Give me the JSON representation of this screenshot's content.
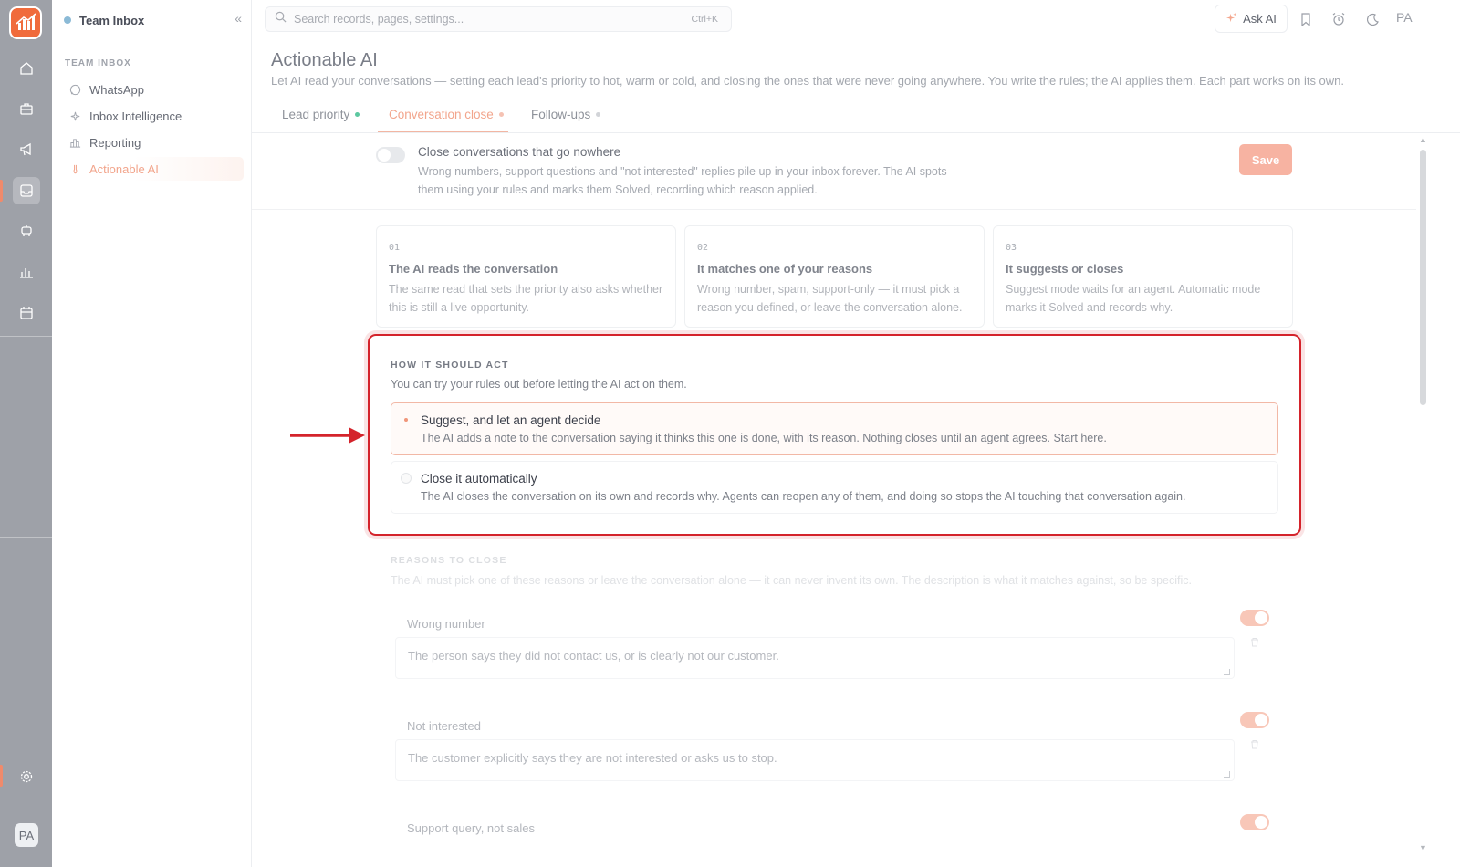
{
  "sidebar": {
    "title": "Team Inbox",
    "collapse_glyph": "«",
    "section_label": "TEAM INBOX",
    "items": [
      {
        "label": "WhatsApp",
        "icon": "whatsapp-icon"
      },
      {
        "label": "Inbox Intelligence",
        "icon": "sparkle-icon"
      },
      {
        "label": "Reporting",
        "icon": "bar-chart-icon"
      },
      {
        "label": "Actionable AI",
        "icon": "flask-icon",
        "active": true
      }
    ]
  },
  "rail": {
    "avatar": "PA",
    "icons": [
      "home-icon",
      "briefcase-icon",
      "megaphone-icon",
      "inbox-icon",
      "robot-icon",
      "chart-icon",
      "calendar-icon",
      "settings-icon"
    ]
  },
  "topbar": {
    "search_placeholder": "Search records, pages, settings...",
    "shortcut": "Ctrl+K",
    "ask_ai": "Ask AI",
    "avatar": "PA"
  },
  "page": {
    "title": "Actionable AI",
    "subtitle": "Let AI read your conversations — setting each lead's priority to hot, warm or cold, and closing the ones that were never going anywhere. You write the rules; the AI applies them. Each part works on its own."
  },
  "tabs": [
    {
      "label": "Lead priority",
      "dot_color": "#5cc8a0"
    },
    {
      "label": "Conversation close",
      "dot_color": "#f5c2b3",
      "active": true
    },
    {
      "label": "Follow-ups",
      "dot_color": "#d2d4d8"
    }
  ],
  "close_setting": {
    "title": "Close conversations that go nowhere",
    "description": "Wrong numbers, support questions and \"not interested\" replies pile up in your inbox forever. The AI spots them using your rules and marks them Solved, recording which reason applied.",
    "enabled": false,
    "save_label": "Save"
  },
  "steps": [
    {
      "num": "01",
      "title": "The AI reads the conversation",
      "desc": "The same read that sets the priority also asks whether this is still a live opportunity."
    },
    {
      "num": "02",
      "title": "It matches one of your reasons",
      "desc": "Wrong number, spam, support-only — it must pick a reason you defined, or leave the conversation alone."
    },
    {
      "num": "03",
      "title": "It suggests or closes",
      "desc": "Suggest mode waits for an agent. Automatic mode marks it Solved and records why."
    }
  ],
  "act": {
    "label": "HOW IT SHOULD ACT",
    "hint": "You can try your rules out before letting the AI act on them.",
    "options": [
      {
        "title": "Suggest, and let an agent decide",
        "desc": "The AI adds a note to the conversation saying it thinks this one is done, with its reason. Nothing closes until an agent agrees. Start here.",
        "selected": true
      },
      {
        "title": "Close it automatically",
        "desc": "The AI closes the conversation on its own and records why. Agents can reopen any of them, and doing so stops the AI touching that conversation again.",
        "selected": false
      }
    ]
  },
  "reasons": {
    "label": "REASONS TO CLOSE",
    "hint": "The AI must pick one of these reasons or leave the conversation alone — it can never invent its own. The description is what it matches against, so be specific.",
    "items": [
      {
        "name": "Wrong number",
        "desc": "The person says they did not contact us, or is clearly not our customer.",
        "enabled": true
      },
      {
        "name": "Not interested",
        "desc": "The customer explicitly says they are not interested or asks us to stop.",
        "enabled": true
      },
      {
        "name": "Support query, not sales",
        "desc": "",
        "enabled": true
      }
    ]
  },
  "colors": {
    "accent": "#f2a58c",
    "highlight": "#d4232b",
    "rail": "#9ea1a8"
  }
}
